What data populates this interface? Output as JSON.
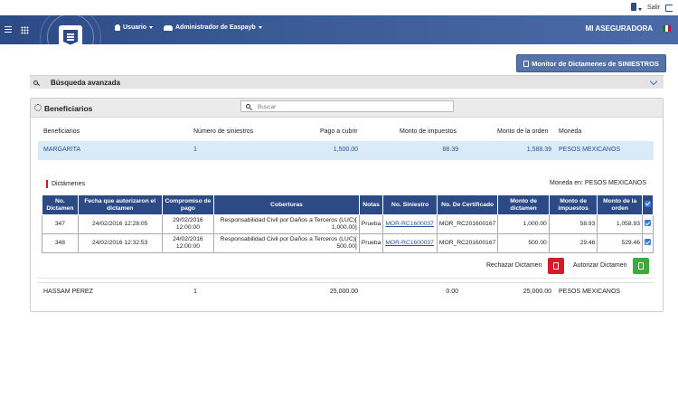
{
  "topbar": {
    "logout_label": "Salir"
  },
  "navbar": {
    "user_menu": "Usuario",
    "admin_menu": "Administrador de Easpayb",
    "brand": "MI ASEGURADORA"
  },
  "monitor_button": {
    "label": "Monitor de Dictamenes de SINIESTROS"
  },
  "advanced_search": {
    "label": "Búsqueda avanzada"
  },
  "panel": {
    "title": "Beneficiarios",
    "search_placeholder": "Buscar"
  },
  "beneficiaries": {
    "headers": [
      "Beneficiarios",
      "Número de siniestros",
      "Pago a cubrir",
      "Monto de impuestos",
      "Monto de la orden",
      "Moneda"
    ],
    "rows": [
      {
        "name": "MARGARITA",
        "claims": "1",
        "payment": "1,500.00",
        "taxes": "88.39",
        "order_amount": "1,588.39",
        "currency": "PESOS MEXICANOS"
      },
      {
        "name": "HASSAM PEREZ",
        "claims": "1",
        "payment": "25,000.00",
        "taxes": "0.00",
        "order_amount": "25,000.00",
        "currency": "PESOS MEXICANOS"
      }
    ]
  },
  "dictamenes": {
    "section_label": "Dictámenes",
    "currency_note": "Moneda en: PESOS MEXICANOS",
    "headers": [
      "No. Dictamen",
      "Fecha que autorizaron el dictamen",
      "Compromiso de pago",
      "Coberturas",
      "Notas",
      "No. Siniestro",
      "No. De Certificado",
      "Monto de dictamen",
      "Monto de impuestos",
      "Monto de la orden"
    ],
    "rows": [
      {
        "num": "347",
        "auth_date": "24/02/2016 12:28:05",
        "payment_date": "29/02/2016 12:00:00",
        "coverage": "Responsabilidad Civil por Daños a Terceros (LUC)[ 1,000.00]",
        "notes": "Prueba",
        "claim": "MOR-RC1600037",
        "certificate": "MOR_RC201600167",
        "amount": "1,000.00",
        "taxes": "58.93",
        "order": "1,058.93"
      },
      {
        "num": "348",
        "auth_date": "24/02/2016 12:32:53",
        "payment_date": "24/02/2016 12:00:00",
        "coverage": "Responsabilidad Civil por Daños a Terceros (LUC)[ 500.00]",
        "notes": "Prueba",
        "claim": "MOR-RC1600037",
        "certificate": "MOR_RC201600167",
        "amount": "500.00",
        "taxes": "29.46",
        "order": "529.46"
      }
    ],
    "reject_label": "Rechazar Dictamen",
    "approve_label": "Autorizar Dictamen"
  },
  "colors": {
    "navbar": "#2c4b86",
    "reject": "#d9192b",
    "approve": "#3daa3d",
    "highlight_row": "#d8ebf7"
  }
}
